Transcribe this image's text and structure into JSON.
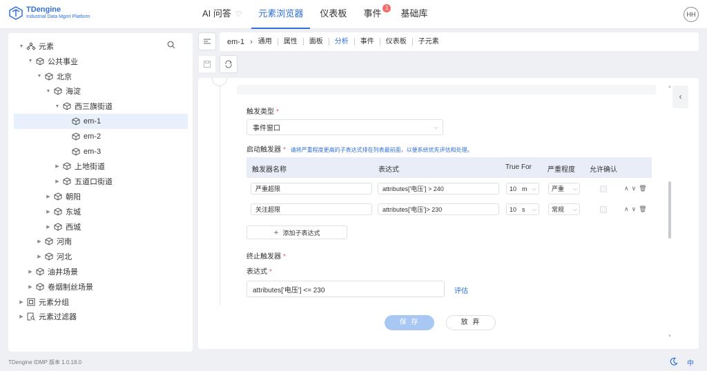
{
  "app": {
    "logo_name": "TDengine",
    "logo_subtitle": "Industrial Data Mgmt Platform",
    "nav": [
      {
        "label": "AI 问答"
      },
      {
        "label": "元素浏览器",
        "active": true
      },
      {
        "label": "仪表板"
      },
      {
        "label": "事件",
        "badge": "1"
      },
      {
        "label": "基础库"
      }
    ],
    "user_initials": "HH",
    "accent_color": "#2f6fd8"
  },
  "tree": {
    "nodes": [
      {
        "label": "元素",
        "icon": "org-icon",
        "expanded": true
      },
      {
        "label": "公共事业",
        "icon": "cube-icon",
        "expanded": true
      },
      {
        "label": "北京",
        "icon": "cube-icon",
        "expanded": true
      },
      {
        "label": "海淀",
        "icon": "cube-icon",
        "expanded": true
      },
      {
        "label": "西三旗街道",
        "icon": "cube-icon",
        "expanded": true
      },
      {
        "label": "em-1",
        "icon": "cube-icon",
        "selected": true
      },
      {
        "label": "em-2",
        "icon": "cube-icon"
      },
      {
        "label": "em-3",
        "icon": "cube-icon"
      },
      {
        "label": "上地街道",
        "icon": "cube-icon",
        "expanded": false
      },
      {
        "label": "五道口街道",
        "icon": "cube-icon",
        "expanded": false
      },
      {
        "label": "朝阳",
        "icon": "cube-icon",
        "expanded": false
      },
      {
        "label": "东城",
        "icon": "cube-icon",
        "expanded": false
      },
      {
        "label": "西城",
        "icon": "cube-icon",
        "expanded": false
      },
      {
        "label": "河南",
        "icon": "cube-icon",
        "expanded": false
      },
      {
        "label": "河北",
        "icon": "cube-icon",
        "expanded": false
      },
      {
        "label": "油井场景",
        "icon": "cube-icon",
        "expanded": false
      },
      {
        "label": "卷烟制丝场景",
        "icon": "cube-icon",
        "expanded": false
      },
      {
        "label": "元素分组",
        "icon": "group-icon",
        "expanded": false
      },
      {
        "label": "元素过滤器",
        "icon": "filter-icon",
        "expanded": false
      }
    ]
  },
  "breadcrumb": {
    "current": "em-1",
    "tabs": [
      "通用",
      "属性",
      "面板",
      "分析",
      "事件",
      "仪表板",
      "子元素"
    ],
    "active_tab": "分析"
  },
  "form": {
    "trigger_type_label": "触发类型",
    "trigger_type_value": "事件窗口",
    "start_trigger_label": "启动触发器",
    "start_trigger_hint": "请将严重程度更高的子表达式排在列表最前面，以便系统优先评估和处理。",
    "columns": [
      "触发器名称",
      "表达式",
      "True For",
      "严重程度",
      "允许确认"
    ],
    "rows": [
      {
        "name": "严重超限",
        "expression": "attributes['电压'] > 240",
        "true_for": "10",
        "unit": "m",
        "severity": "严重"
      },
      {
        "name": "关注超限",
        "expression": "attributes['电压']> 230",
        "true_for": "10",
        "unit": "s",
        "severity": "常规"
      }
    ],
    "add_button": "添加子表达式",
    "end_trigger_label": "终止触发器",
    "expression_label": "表达式",
    "expression_value": "attributes['电压'] <= 230",
    "evaluate_link": "评估",
    "save_button": "保 存",
    "cancel_button": "放 弃"
  },
  "footer": {
    "version_text": "TDengine IDMP 版本 1.0.18.0",
    "language": "中"
  }
}
